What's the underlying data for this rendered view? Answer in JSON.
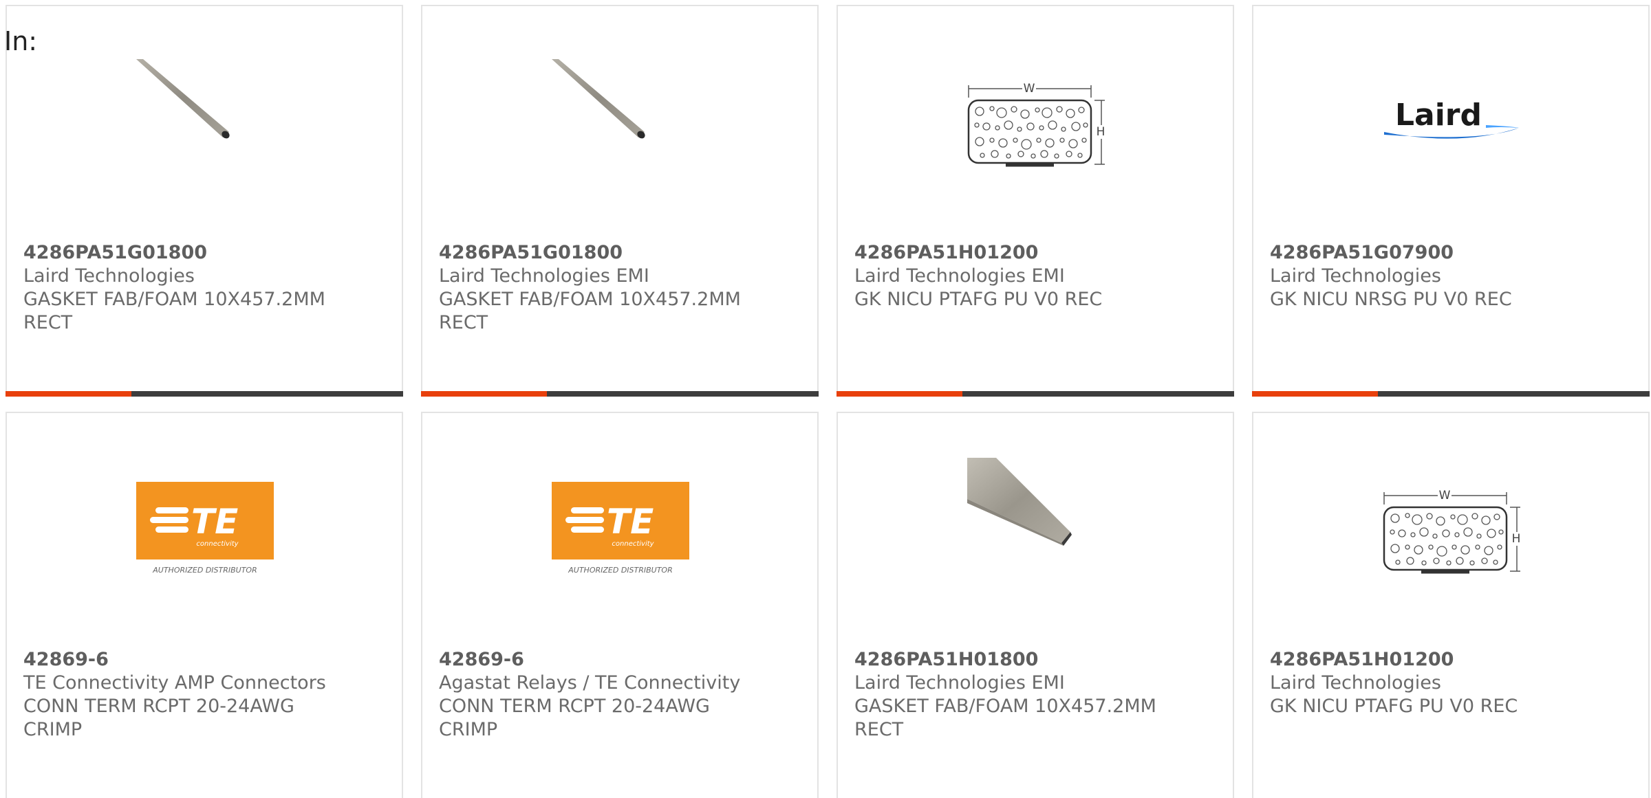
{
  "filter_label": "In:",
  "colors": {
    "accent": "#e8400c",
    "bar": "#3d3d3d",
    "te_orange": "#f39420"
  },
  "products": [
    {
      "part": "4286PA51G01800",
      "manufacturer": "Laird Technologies",
      "description": "GASKET FAB/FOAM 10X457.2MM RECT",
      "image": "gasket-strip-image"
    },
    {
      "part": "4286PA51G01800",
      "manufacturer": "Laird Technologies EMI",
      "description": "GASKET FAB/FOAM 10X457.2MM RECT",
      "image": "gasket-strip-image"
    },
    {
      "part": "4286PA51H01200",
      "manufacturer": "Laird Technologies EMI",
      "description": "GK NICU PTAFG PU V0 REC",
      "image": "perforated-gasket-diagram"
    },
    {
      "part": "4286PA51G07900",
      "manufacturer": "Laird Technologies",
      "description": "GK NICU NRSG PU V0 REC",
      "image": "laird-logo",
      "logo_text": "Laird"
    },
    {
      "part": "42869-6",
      "manufacturer": "TE Connectivity AMP Connectors",
      "description": "CONN TERM RCPT 20-24AWG CRIMP",
      "image": "te-connectivity-logo",
      "logo_text": "TE",
      "logo_sub": "connectivity",
      "logo_caption": "AUTHORIZED DISTRIBUTOR"
    },
    {
      "part": "42869-6",
      "manufacturer": "Agastat Relays / TE Connectivity",
      "description": "CONN TERM RCPT 20-24AWG CRIMP",
      "image": "te-connectivity-logo",
      "logo_text": "TE",
      "logo_sub": "connectivity",
      "logo_caption": "AUTHORIZED DISTRIBUTOR"
    },
    {
      "part": "4286PA51H01800",
      "manufacturer": "Laird Technologies EMI",
      "description": "GASKET FAB/FOAM 10X457.2MM RECT",
      "image": "gasket-strip-image"
    },
    {
      "part": "4286PA51H01200",
      "manufacturer": "Laird Technologies",
      "description": "GK NICU PTAFG PU V0 REC",
      "image": "perforated-gasket-diagram"
    }
  ],
  "diagram_labels": {
    "width": "W",
    "height": "H"
  }
}
